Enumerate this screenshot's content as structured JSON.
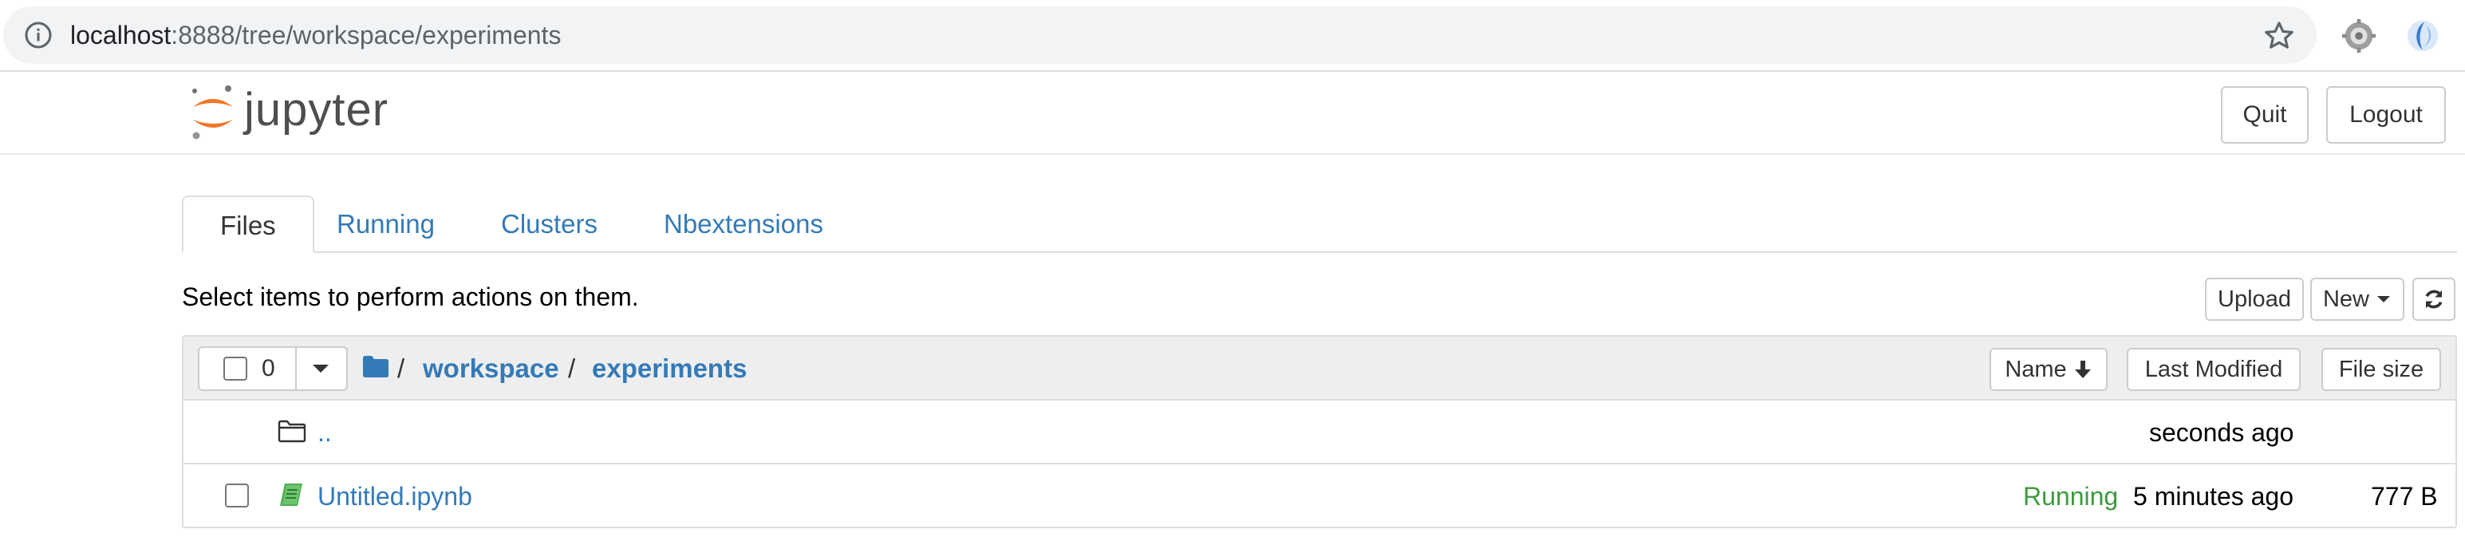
{
  "browser": {
    "url_host": "localhost",
    "url_path": ":8888/tree/workspace/experiments",
    "icons": [
      "info-icon",
      "star-icon",
      "gear-extension-icon",
      "profile-extension-icon"
    ]
  },
  "header": {
    "logo_text": "jupyter",
    "quit_label": "Quit",
    "logout_label": "Logout"
  },
  "tabs": [
    {
      "label": "Files",
      "active": true
    },
    {
      "label": "Running",
      "active": false
    },
    {
      "label": "Clusters",
      "active": false
    },
    {
      "label": "Nbextensions",
      "active": false
    }
  ],
  "toolbar": {
    "select_text": "Select items to perform actions on them.",
    "upload_label": "Upload",
    "new_label": "New",
    "refresh_icon": "refresh-icon"
  },
  "list_header": {
    "selected_count": "0",
    "breadcrumb_sep": "/",
    "breadcrumb": [
      "workspace",
      "experiments"
    ],
    "sort_name_label": "Name",
    "sort_modified_label": "Last Modified",
    "sort_size_label": "File size"
  },
  "rows": [
    {
      "name": "..",
      "type": "folder",
      "modified": "seconds ago",
      "status": "",
      "size": ""
    },
    {
      "name": "Untitled.ipynb",
      "type": "notebook",
      "modified": "5 minutes ago",
      "status": "Running",
      "size": "777 B"
    }
  ],
  "colors": {
    "link": "#337ab7",
    "running": "#3c9a3c",
    "notebook_icon": "#4caf50",
    "logo_orange": "#f37626"
  }
}
